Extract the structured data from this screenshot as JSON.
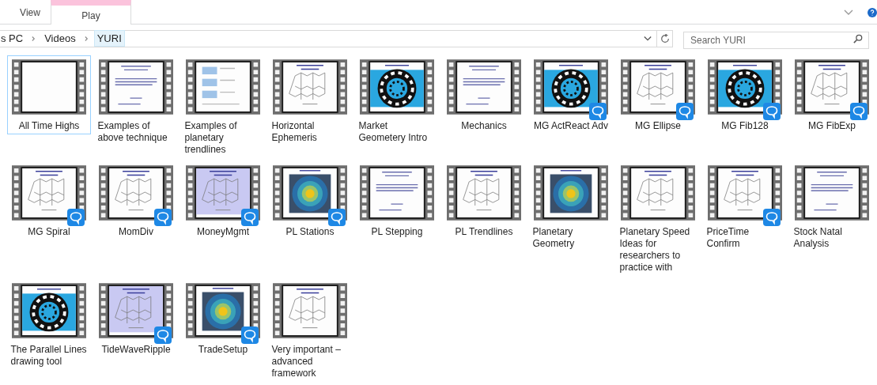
{
  "ribbon": {
    "tabs": [
      {
        "label": "View",
        "selected": false
      },
      {
        "label": "Play",
        "selected": true
      }
    ]
  },
  "address_bar": {
    "crumbs": [
      {
        "label": "s PC",
        "selected": false
      },
      {
        "label": "Videos",
        "selected": false
      },
      {
        "label": "YURI",
        "selected": true
      }
    ]
  },
  "search": {
    "placeholder": "Search YURI"
  },
  "items": [
    {
      "name": "All Time Highs",
      "selected": true,
      "badge": false
    },
    {
      "name": "Examples of above technique",
      "selected": false,
      "badge": false
    },
    {
      "name": "Examples of planetary trendlines",
      "selected": false,
      "badge": false
    },
    {
      "name": "Horizontal Ephemeris",
      "selected": false,
      "badge": false
    },
    {
      "name": "Market Geometery Intro",
      "selected": false,
      "badge": false
    },
    {
      "name": "Mechanics",
      "selected": false,
      "badge": false
    },
    {
      "name": "MG ActReact Adv",
      "selected": false,
      "badge": true
    },
    {
      "name": "MG Ellipse",
      "selected": false,
      "badge": true
    },
    {
      "name": "MG Fib128",
      "selected": false,
      "badge": true
    },
    {
      "name": "MG FibExp",
      "selected": false,
      "badge": true
    },
    {
      "name": "MG Spiral",
      "selected": false,
      "badge": true
    },
    {
      "name": "MomDiv",
      "selected": false,
      "badge": true
    },
    {
      "name": "MoneyMgmt",
      "selected": false,
      "badge": true
    },
    {
      "name": "PL Stations",
      "selected": false,
      "badge": true
    },
    {
      "name": "PL Stepping",
      "selected": false,
      "badge": false
    },
    {
      "name": "PL Trendlines",
      "selected": false,
      "badge": false
    },
    {
      "name": "Planetary Geometry",
      "selected": false,
      "badge": false
    },
    {
      "name": "Planetary Speed Ideas for researchers to practice with",
      "selected": false,
      "badge": false
    },
    {
      "name": "PriceTime Confirm",
      "selected": false,
      "badge": true
    },
    {
      "name": "Stock Natal Analysis",
      "selected": false,
      "badge": false
    },
    {
      "name": "The Parallel Lines drawing tool",
      "selected": false,
      "badge": false
    },
    {
      "name": "TideWaveRipple",
      "selected": false,
      "badge": true
    },
    {
      "name": "TradeSetup",
      "selected": false,
      "badge": true
    },
    {
      "name": "Very important – advanced framework",
      "selected": false,
      "badge": false
    }
  ]
}
